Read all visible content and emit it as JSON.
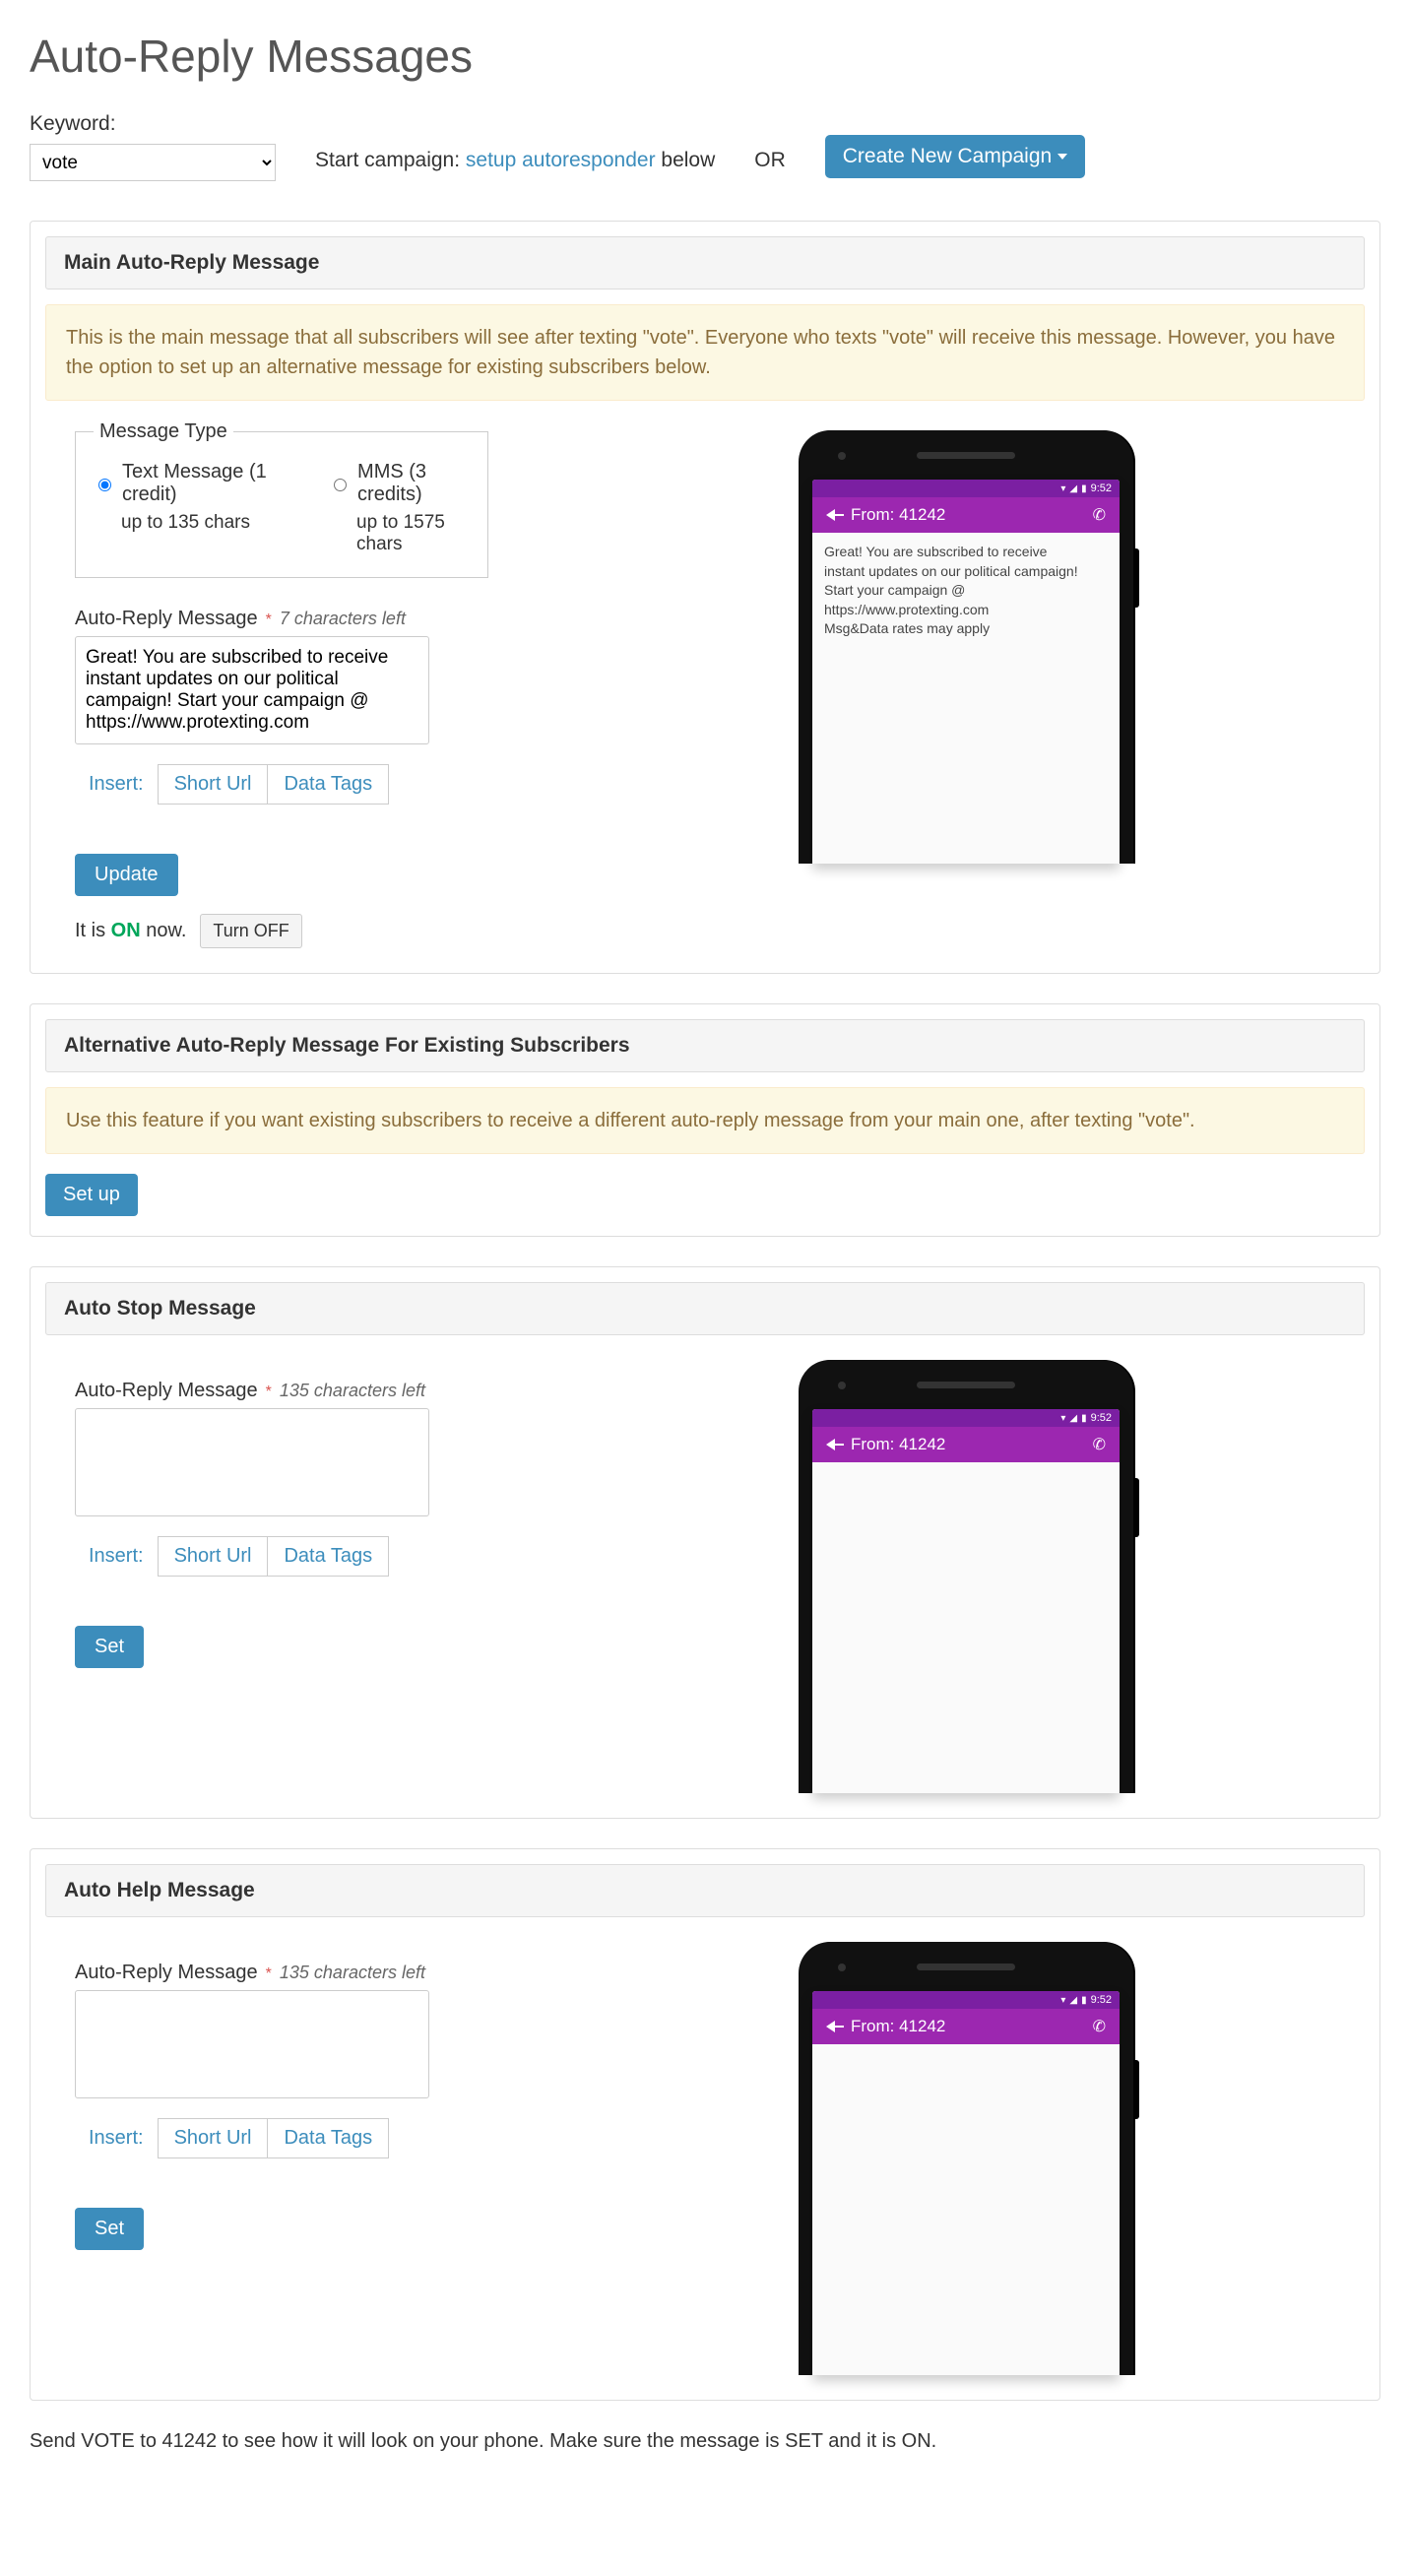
{
  "page_title": "Auto-Reply Messages",
  "keyword": {
    "label": "Keyword:",
    "value": "vote"
  },
  "campaign": {
    "start_text": "Start campaign:",
    "link_text": "setup autoresponder",
    "after_text": " below",
    "or": "OR",
    "create_button": "Create New Campaign"
  },
  "main": {
    "header": "Main Auto-Reply Message",
    "info": "This is the main message that all subscribers will see after texting \"vote\". Everyone who texts \"vote\" will receive this message. However, you have the option to set up an alternative message for existing subscribers below.",
    "msg_type_legend": "Message Type",
    "radio_sms": "Text Message (1 credit)",
    "radio_sms_sub": "up to 135 chars",
    "radio_mms": "MMS (3 credits)",
    "radio_mms_sub": "up to 1575 chars",
    "field_label": "Auto-Reply Message",
    "chars_left": "7  characters left",
    "textarea_value": "Great! You are subscribed to receive instant updates on our political campaign! Start your campaign @ https://www.protexting.com",
    "insert_label": "Insert:",
    "short_url": "Short Url",
    "data_tags": "Data Tags",
    "update_btn": "Update",
    "status_prefix": "It is ",
    "status_on": "ON",
    "status_suffix": " now.",
    "turn_off": "Turn OFF"
  },
  "phone": {
    "time": "9:52",
    "from": "From: 41242",
    "msg_line1": "Great! You are subscribed to receive",
    "msg_line2": "instant updates on our political campaign!",
    "msg_line3": "Start your campaign @",
    "msg_line4": "https://www.protexting.com",
    "msg_line5": "Msg&Data rates may apply"
  },
  "alt": {
    "header": "Alternative Auto-Reply Message For Existing Subscribers",
    "info": "Use this feature if you want existing subscribers to receive a different auto-reply message from your main one, after texting \"vote\".",
    "setup_btn": "Set up"
  },
  "stop": {
    "header": "Auto Stop Message",
    "field_label": "Auto-Reply Message",
    "chars_left": "135  characters left",
    "textarea_value": "",
    "insert_label": "Insert:",
    "short_url": "Short Url",
    "data_tags": "Data Tags",
    "set_btn": "Set"
  },
  "help": {
    "header": "Auto Help Message",
    "field_label": "Auto-Reply Message",
    "chars_left": "135  characters left",
    "textarea_value": "",
    "insert_label": "Insert:",
    "short_url": "Short Url",
    "data_tags": "Data Tags",
    "set_btn": "Set"
  },
  "footer": {
    "text_a": "Send VOTE to ",
    "code": "41242",
    "text_b": "  to see how it will look on your phone. Make sure the message is SET and it is ON."
  }
}
